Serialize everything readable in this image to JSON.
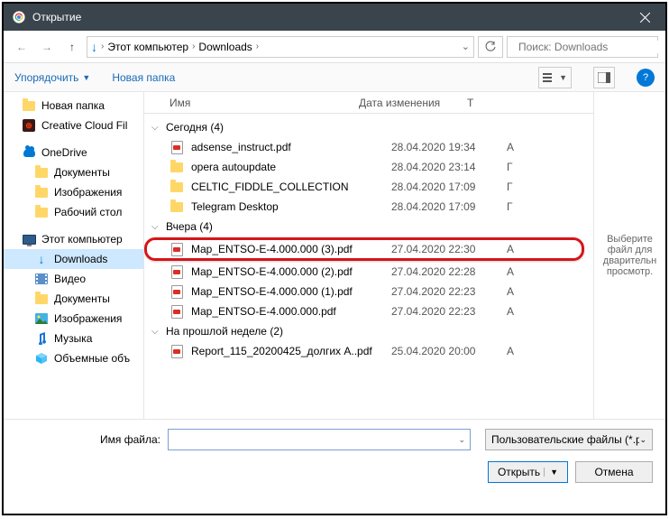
{
  "titlebar": {
    "title": "Открытие"
  },
  "nav": {
    "path": [
      "Этот компьютер",
      "Downloads"
    ],
    "search_placeholder": "Поиск: Downloads"
  },
  "toolbar": {
    "organize": "Упорядочить",
    "newfolder": "Новая папка"
  },
  "tree": [
    {
      "icon": "folder",
      "label": "Новая папка"
    },
    {
      "icon": "cc",
      "label": "Creative Cloud Fil"
    },
    {
      "icon": "onedrive",
      "label": "OneDrive"
    },
    {
      "icon": "folder",
      "label": "Документы",
      "indent": 1
    },
    {
      "icon": "folder",
      "label": "Изображения",
      "indent": 1
    },
    {
      "icon": "folder",
      "label": "Рабочий стол",
      "indent": 1
    },
    {
      "icon": "pc",
      "label": "Этот компьютер"
    },
    {
      "icon": "download",
      "label": "Downloads",
      "indent": 1,
      "sel": true
    },
    {
      "icon": "video",
      "label": "Видео",
      "indent": 1
    },
    {
      "icon": "folder",
      "label": "Документы",
      "indent": 1
    },
    {
      "icon": "image",
      "label": "Изображения",
      "indent": 1
    },
    {
      "icon": "music",
      "label": "Музыка",
      "indent": 1
    },
    {
      "icon": "cube",
      "label": "Объемные объ",
      "indent": 1
    }
  ],
  "columns": {
    "name": "Имя",
    "date": "Дата изменения",
    "type": "Т"
  },
  "groups": [
    {
      "label": "Сегодня (4)",
      "items": [
        {
          "icon": "pdf",
          "name": "adsense_instruct.pdf",
          "date": "28.04.2020 19:34",
          "t": "A"
        },
        {
          "icon": "folder",
          "name": "opera autoupdate",
          "date": "28.04.2020 23:14",
          "t": "Г"
        },
        {
          "icon": "folder",
          "name": "CELTIC_FIDDLE_COLLECTION",
          "date": "28.04.2020 17:09",
          "t": "Г"
        },
        {
          "icon": "folder",
          "name": "Telegram Desktop",
          "date": "28.04.2020 17:09",
          "t": "Г"
        }
      ]
    },
    {
      "label": "Вчера (4)",
      "items": [
        {
          "icon": "pdf",
          "name": "Map_ENTSO-E-4.000.000 (3).pdf",
          "date": "27.04.2020 22:30",
          "t": "A",
          "hl": true
        },
        {
          "icon": "pdf",
          "name": "Map_ENTSO-E-4.000.000 (2).pdf",
          "date": "27.04.2020 22:28",
          "t": "A"
        },
        {
          "icon": "pdf",
          "name": "Map_ENTSO-E-4.000.000 (1).pdf",
          "date": "27.04.2020 22:23",
          "t": "A"
        },
        {
          "icon": "pdf",
          "name": "Map_ENTSO-E-4.000.000.pdf",
          "date": "27.04.2020 22:23",
          "t": "A"
        }
      ]
    },
    {
      "label": "На прошлой неделе (2)",
      "items": [
        {
          "icon": "pdf",
          "name": "Report_115_20200425_долгих A..pdf",
          "date": "25.04.2020 20:00",
          "t": "A"
        }
      ]
    }
  ],
  "preview": "Выберите файл для дварительн просмотр.",
  "bottom": {
    "filename_label": "Имя файла:",
    "filename_value": "",
    "filter": "Пользовательские файлы (*.p",
    "open": "Открыть",
    "cancel": "Отмена"
  }
}
